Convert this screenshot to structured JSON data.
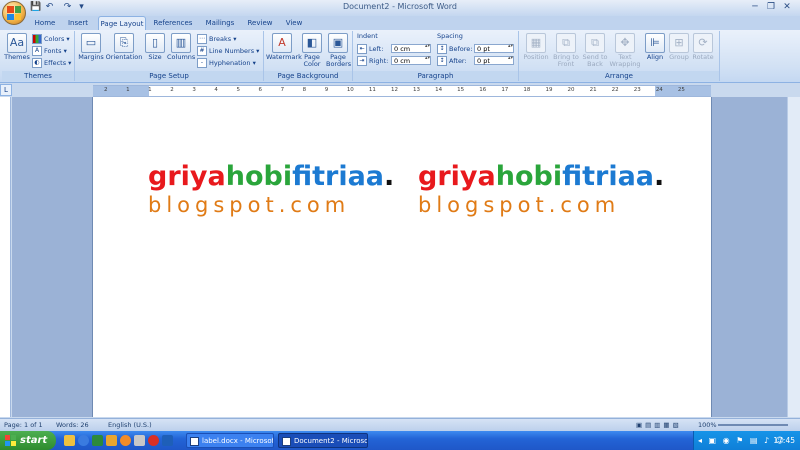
{
  "window": {
    "title": "Document2 - Microsoft Word",
    "controls": {
      "minimize": "─",
      "maximize": "❐",
      "close": "✕"
    }
  },
  "quick_access": {
    "save": "💾",
    "undo": "↶",
    "redo": "↷",
    "customize": "▾"
  },
  "tabs": [
    "Home",
    "Insert",
    "Page Layout",
    "References",
    "Mailings",
    "Review",
    "View"
  ],
  "active_tab": "Page Layout",
  "ribbon": {
    "themes": {
      "label": "Themes",
      "themes_button": "Themes",
      "colors": "Colors ▾",
      "fonts": "Fonts ▾",
      "effects": "Effects ▾"
    },
    "page_setup": {
      "label": "Page Setup",
      "margins": "Margins",
      "orientation": "Orientation",
      "size": "Size",
      "columns": "Columns",
      "breaks": "Breaks ▾",
      "line_numbers": "Line Numbers ▾",
      "hyphenation": "Hyphenation ▾"
    },
    "page_background": {
      "label": "Page Background",
      "watermark": "Watermark",
      "page_color": "Page Color",
      "page_borders": "Page Borders"
    },
    "paragraph": {
      "label": "Paragraph",
      "indent_header": "Indent",
      "left_label": "Left:",
      "left_value": "0 cm",
      "right_label": "Right:",
      "right_value": "0 cm",
      "spacing_header": "Spacing",
      "before_label": "Before:",
      "before_value": "0 pt",
      "after_label": "After:",
      "after_value": "0 pt"
    },
    "arrange": {
      "label": "Arrange",
      "position": "Position",
      "bring_to_front": "Bring to Front",
      "send_to_back": "Send to Back",
      "text_wrapping": "Text Wrapping",
      "align": "Align",
      "group": "Group",
      "rotate": "Rotate"
    }
  },
  "ruler": {
    "numbers": [
      "2",
      "1",
      "1",
      "2",
      "3",
      "4",
      "5",
      "6",
      "7",
      "8",
      "9",
      "10",
      "11",
      "12",
      "13",
      "14",
      "15",
      "16",
      "17",
      "18",
      "19",
      "20",
      "21",
      "22",
      "23",
      "24",
      "25"
    ]
  },
  "document": {
    "labels": [
      {
        "brand_parts": [
          {
            "text": "griya",
            "color": "#e8191d"
          },
          {
            "text": "hobi",
            "color": "#2aa53b"
          },
          {
            "text": "fitriaa",
            "color": "#1c7ad2"
          },
          {
            "text": ".",
            "color": "#111111"
          }
        ],
        "domain": "blogspot.com"
      },
      {
        "brand_parts": [
          {
            "text": "griya",
            "color": "#e8191d"
          },
          {
            "text": "hobi",
            "color": "#2aa53b"
          },
          {
            "text": "fitriaa",
            "color": "#1c7ad2"
          },
          {
            "text": ".",
            "color": "#111111"
          }
        ],
        "domain": "blogspot.com"
      }
    ]
  },
  "status": {
    "page": "Page: 1 of 1",
    "words": "Words: 26",
    "language": "English (U.S.)",
    "zoom": "100%"
  },
  "taskbar": {
    "start": "start",
    "tasks": [
      "label.docx - Microsoft...",
      "Document2 - Microsoft ..."
    ],
    "clock": "17:45"
  }
}
